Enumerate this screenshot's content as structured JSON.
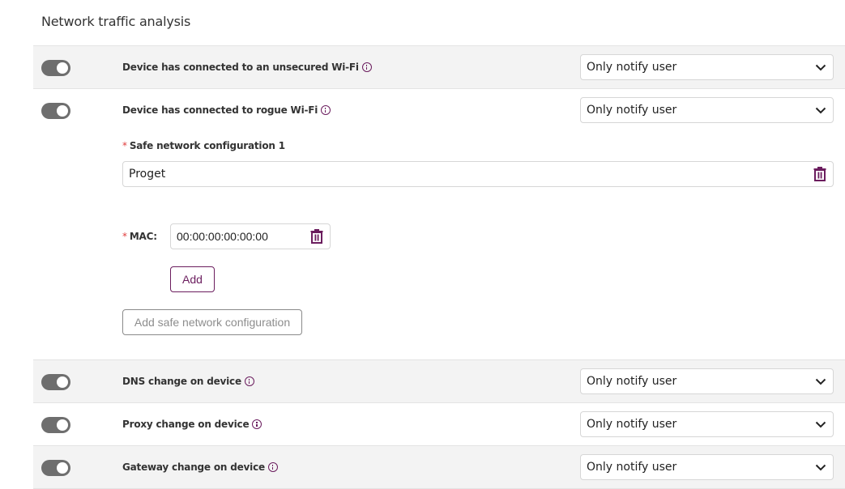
{
  "section": {
    "title": "Network traffic analysis"
  },
  "colors": {
    "accent": "#6b1d5e",
    "required": "#e03c3c",
    "toggle_on": "#6e6e6e",
    "row_gray": "#f3f3f3"
  },
  "rules": [
    {
      "label": "Device has connected to an unsecured Wi-Fi",
      "enabled": true,
      "action": "Only notify user",
      "info_icon": "info-icon"
    },
    {
      "label": "Device has connected to rogue Wi-Fi",
      "enabled": true,
      "action": "Only notify user",
      "info_icon": "info-icon"
    },
    {
      "label": "DNS change on device",
      "enabled": true,
      "action": "Only notify user",
      "info_icon": "info-icon"
    },
    {
      "label": "Proxy change on device",
      "enabled": true,
      "action": "Only notify user",
      "info_icon": "info-icon"
    },
    {
      "label": "Gateway change on device",
      "enabled": true,
      "action": "Only notify user",
      "info_icon": "info-icon"
    }
  ],
  "safe_network": {
    "required_mark": "*",
    "config_label": "Safe network configuration 1",
    "config_value": "Proget",
    "mac_label": "MAC:",
    "mac_value": "00:00:00:00:00:00",
    "add_label": "Add",
    "add_config_label": "Add safe network configuration"
  }
}
